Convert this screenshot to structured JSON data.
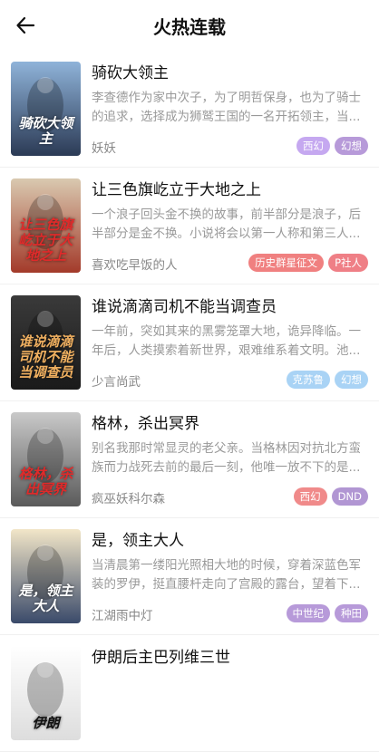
{
  "header": {
    "title": "火热连载"
  },
  "books": [
    {
      "title": "骑砍大领主",
      "desc": "李查德作为家中次子，为了明哲保身，也为了骑士的追求，选择成为狮鹫王国的一名开拓领主，当...",
      "author": "妖妖",
      "tags": [
        {
          "label": "西幻",
          "color": "#c5a8f0"
        },
        {
          "label": "幻想",
          "color": "#b79ad9"
        }
      ],
      "cover": {
        "text": "骑砍大领主",
        "bg1": "#8fb3d9",
        "bg2": "#2b3a55",
        "text_color": "#ffffff"
      }
    },
    {
      "title": "让三色旗屹立于大地之上",
      "desc": "一个浪子回头金不换的故事，前半部分是浪子，后半部分是金不换。小说将会以第一人称和第三人...",
      "author": "喜欢吃早饭的人",
      "tags": [
        {
          "label": "历史群星征文",
          "color": "#f08080"
        },
        {
          "label": "P社人",
          "color": "#ef7f86"
        }
      ],
      "cover": {
        "text": "让三色旗屹立于大地之上",
        "bg1": "#d9c9b0",
        "bg2": "#a33a2a",
        "text_color": "#e02a2a"
      }
    },
    {
      "title": "谁说滴滴司机不能当调查员",
      "desc": "一年前，突如其来的黑雾笼罩大地，诡异降临。一年后，人类摸索着新世界，艰难维系着文明。池...",
      "author": "少言尚武",
      "tags": [
        {
          "label": "克苏鲁",
          "color": "#a9d3f5"
        },
        {
          "label": "幻想",
          "color": "#a9d3f5"
        }
      ],
      "cover": {
        "text": "谁说滴滴司机不能当调查员",
        "bg1": "#3a3a3a",
        "bg2": "#1a1a1a",
        "text_color": "#f0b060"
      }
    },
    {
      "title": "格林，杀出冥界",
      "desc": "别名我那时常显灵的老父亲。当格林因对抗北方蛮族而力战死去前的最后一刻，他唯一放不下的是...",
      "author": "疯巫妖科尔森",
      "tags": [
        {
          "label": "西幻",
          "color": "#f08a8a"
        },
        {
          "label": "DND",
          "color": "#b196d3"
        }
      ],
      "cover": {
        "text": "格林，杀出冥界",
        "bg1": "#c9c9c9",
        "bg2": "#5a5a5a",
        "text_color": "#e02a2a"
      }
    },
    {
      "title": "是，领主大人",
      "desc": "当清晨第一缕阳光照相大地的时候，穿着深蓝色军装的罗伊，挺直腰杆走向了宫殿的露台，望着下...",
      "author": "江湖雨中灯",
      "tags": [
        {
          "label": "中世纪",
          "color": "#b79ad9"
        },
        {
          "label": "种田",
          "color": "#b79ad9"
        }
      ],
      "cover": {
        "text": "是，领主大人",
        "bg1": "#f2e6c8",
        "bg2": "#3a4a6a",
        "text_color": "#ffffff"
      }
    },
    {
      "title": "伊朗后主巴列维三世",
      "desc": "",
      "author": "",
      "tags": [],
      "cover": {
        "text": "伊朗",
        "bg1": "#ffffff",
        "bg2": "#dddddd",
        "text_color": "#111111"
      }
    }
  ]
}
